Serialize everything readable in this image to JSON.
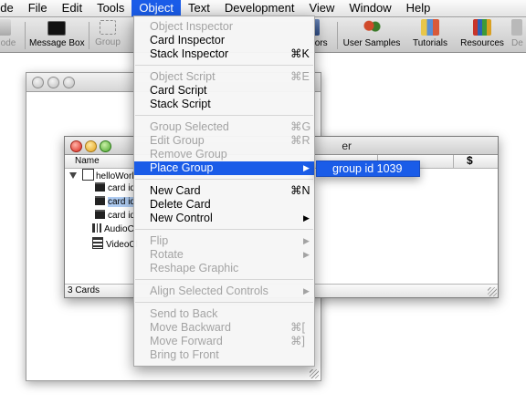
{
  "menubar": {
    "items": [
      "ode",
      "File",
      "Edit",
      "Tools",
      "Object",
      "Text",
      "Development",
      "View",
      "Window",
      "Help"
    ],
    "active": "Object"
  },
  "toolbar": {
    "left": [
      {
        "label": "ode",
        "icon": "code-icon"
      },
      {
        "label": "Message Box",
        "icon": "message-box-icon"
      },
      {
        "label": "Group",
        "icon": "group-icon"
      }
    ],
    "right": [
      {
        "label": "tors",
        "icon": "editors-icon"
      },
      {
        "label": "User Samples",
        "icon": "user-samples-icon"
      },
      {
        "label": "Tutorials",
        "icon": "tutorials-icon"
      },
      {
        "label": "Resources",
        "icon": "resources-icon"
      },
      {
        "label": "De",
        "icon": "dictionary-icon"
      }
    ]
  },
  "app_browser": {
    "title": "er",
    "column_name": "Name",
    "root": "helloWorl",
    "cards": [
      "card id",
      "card id",
      "card id"
    ],
    "audio": "AudioC",
    "video": "VideoCl",
    "status": "3 Cards"
  },
  "object_menu": {
    "sections": [
      [
        {
          "label": "Object Inspector",
          "enabled": false
        },
        {
          "label": "Card Inspector",
          "enabled": true
        },
        {
          "label": "Stack Inspector",
          "shortcut": "⌘K",
          "enabled": true
        }
      ],
      [
        {
          "label": "Object Script",
          "shortcut": "⌘E",
          "enabled": false
        },
        {
          "label": "Card Script",
          "enabled": true
        },
        {
          "label": "Stack Script",
          "enabled": true
        }
      ],
      [
        {
          "label": "Group Selected",
          "shortcut": "⌘G",
          "enabled": false
        },
        {
          "label": "Edit Group",
          "shortcut": "⌘R",
          "enabled": false
        },
        {
          "label": "Remove Group",
          "enabled": false
        },
        {
          "label": "Place Group",
          "submenu": true,
          "enabled": true,
          "highlighted": true
        }
      ],
      [
        {
          "label": "New Card",
          "shortcut": "⌘N",
          "enabled": true
        },
        {
          "label": "Delete Card",
          "enabled": true
        },
        {
          "label": "New Control",
          "submenu": true,
          "enabled": true
        }
      ],
      [
        {
          "label": "Flip",
          "submenu": true,
          "enabled": false
        },
        {
          "label": "Rotate",
          "submenu": true,
          "enabled": false
        },
        {
          "label": "Reshape Graphic",
          "enabled": false
        }
      ],
      [
        {
          "label": "Align Selected Controls",
          "submenu": true,
          "enabled": false
        }
      ],
      [
        {
          "label": "Send to Back",
          "enabled": false
        },
        {
          "label": "Move Backward",
          "shortcut": "⌘[",
          "enabled": false
        },
        {
          "label": "Move Forward",
          "shortcut": "⌘]",
          "enabled": false
        },
        {
          "label": "Bring to Front",
          "enabled": false
        }
      ]
    ],
    "submenu_item": "group id 1039"
  },
  "colors": {
    "highlight": "#1a5ce8",
    "disabled_text": "#a3a3a3",
    "selection": "#aecbf1"
  }
}
